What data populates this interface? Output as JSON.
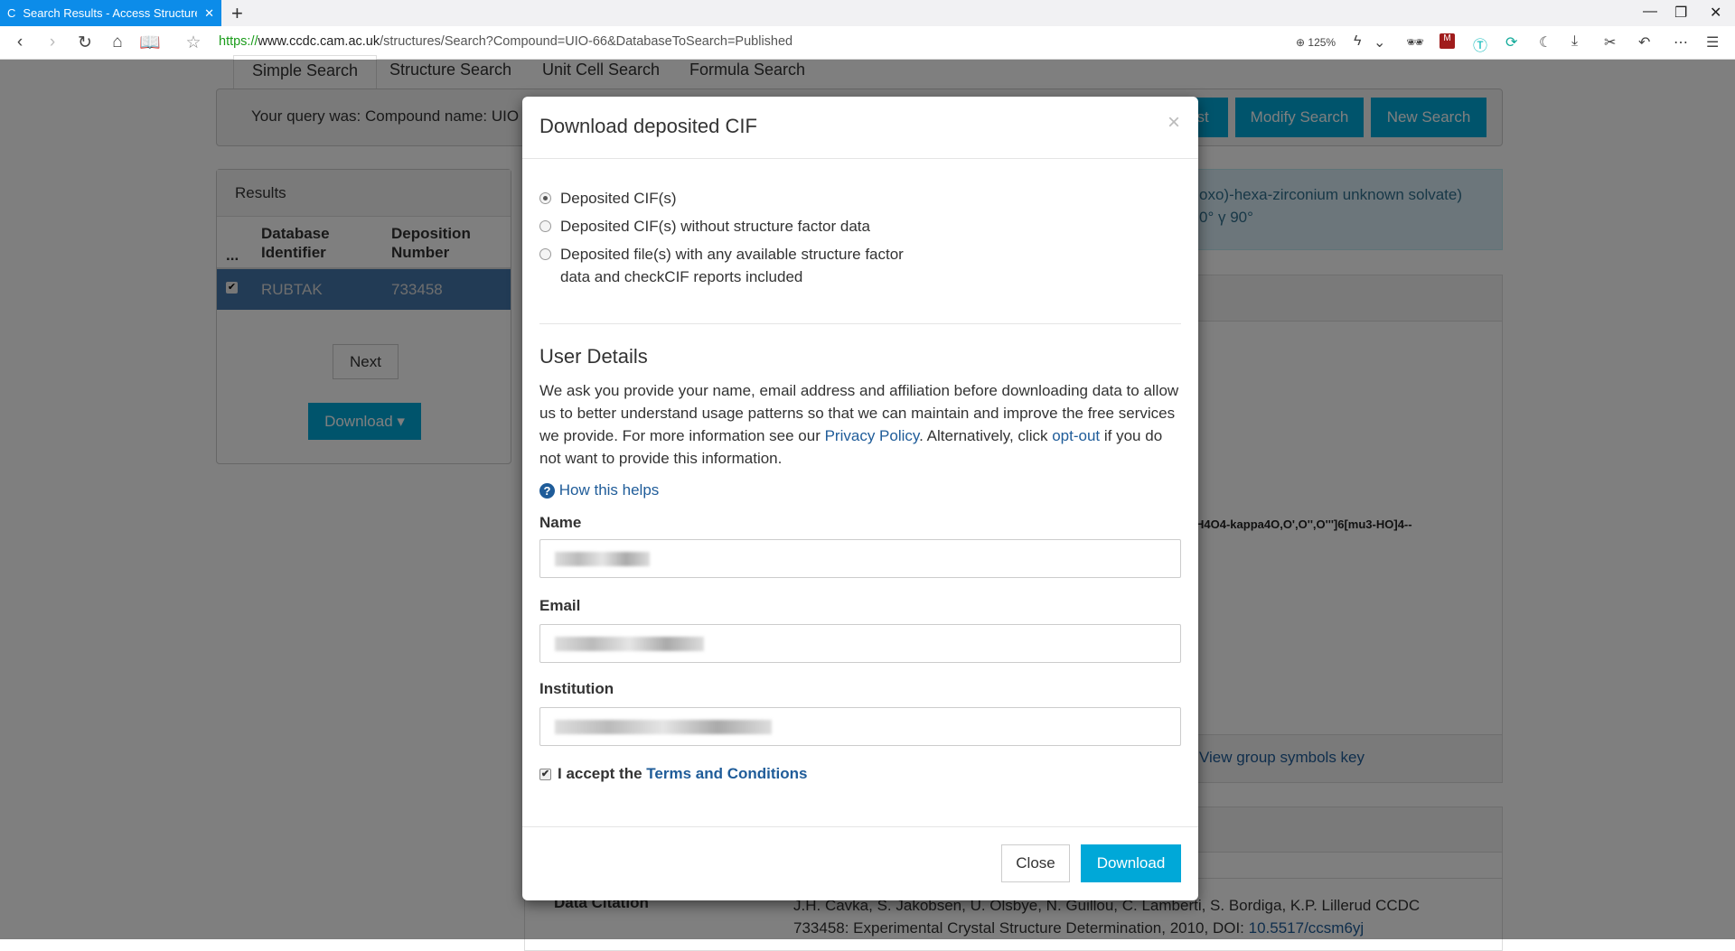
{
  "browser": {
    "tab_title": "Search Results - Access Structures",
    "url_scheme": "https://",
    "url_host": "www.ccdc.cam.ac.uk",
    "url_path": "/structures/Search?Compound=UIO-66&DatabaseToSearch=Published",
    "zoom": "125%"
  },
  "page": {
    "tabs": [
      "Simple Search",
      "Structure Search",
      "Unit Cell Search",
      "Formula Search"
    ],
    "query_text": "Your query was: Compound name: UIO",
    "buttons": {
      "list": "List",
      "modify": "Modify Search",
      "new": "New Search"
    },
    "results": {
      "title": "Results",
      "col0": "...",
      "col1": "Database Identifier",
      "col2": "Deposition Number",
      "rows": [
        {
          "id": "RUBTAK",
          "number": "733458",
          "checked": true
        }
      ],
      "next": "Next",
      "download": "Download"
    },
    "info_line1": "oxo)-hexa-zirconium unknown solvate)",
    "info_line2": "0° γ 90°",
    "formula": "H4O4-kappa4O,O',O'',O''']6[mu3-HO]4--",
    "group_key": "View group symbols key",
    "citation_label": "Data Citation",
    "citation_line1": "J.H. Cavka, S. Jakobsen, U. Olsbye, N. Guillou, C. Lamberti, S. Bordiga, K.P. Lillerud CCDC",
    "citation_line2": "733458: Experimental Crystal Structure Determination, 2010, DOI: ",
    "doi": "10.5517/ccsm6yj"
  },
  "modal": {
    "title": "Download deposited CIF",
    "options": [
      {
        "label": "Deposited CIF(s)",
        "selected": true
      },
      {
        "label": "Deposited CIF(s) without structure factor data",
        "selected": false
      },
      {
        "label": "Deposited file(s) with any available structure factor",
        "label2": "data and checkCIF reports included",
        "selected": false
      }
    ],
    "section": "User Details",
    "para1": "We ask you provide your name, email address and affiliation before downloading data to allow us to better understand usage patterns so that we can maintain and improve the free services we provide. For more information see our ",
    "privacy": "Privacy Policy",
    "para2": ". Alternatively, click ",
    "optout": "opt-out",
    "para3": " if you do not want to provide this information.",
    "how": "How this helps",
    "name_label": "Name",
    "email_label": "Email",
    "institution_label": "Institution",
    "accept": "I accept the ",
    "terms": "Terms and Conditions",
    "accepted": true,
    "close": "Close",
    "download": "Download"
  }
}
